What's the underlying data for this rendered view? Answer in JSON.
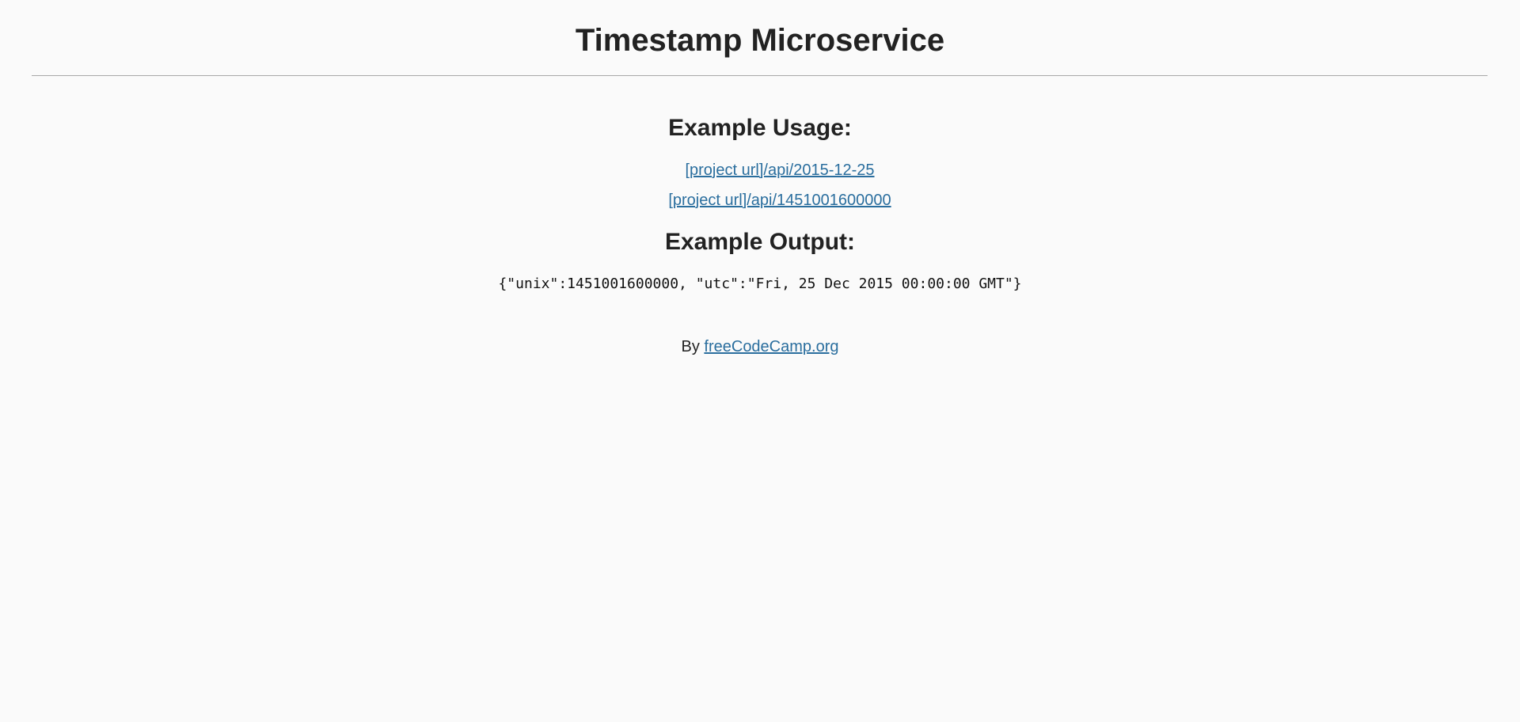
{
  "header": {
    "title": "Timestamp Microservice"
  },
  "main": {
    "usage_heading": "Example Usage:",
    "usage_links": [
      {
        "label": "[project url]/api/2015-12-25"
      },
      {
        "label": "[project url]/api/1451001600000"
      }
    ],
    "output_heading": "Example Output:",
    "output_code": "{\"unix\":1451001600000, \"utc\":\"Fri, 25 Dec 2015 00:00:00 GMT\"}"
  },
  "footer": {
    "prefix": "By",
    "link_label": "freeCodeCamp.org"
  },
  "colors": {
    "background": "#fafafa",
    "text": "#222222",
    "link": "#2a6e9e",
    "divider": "#a8a8a8"
  }
}
